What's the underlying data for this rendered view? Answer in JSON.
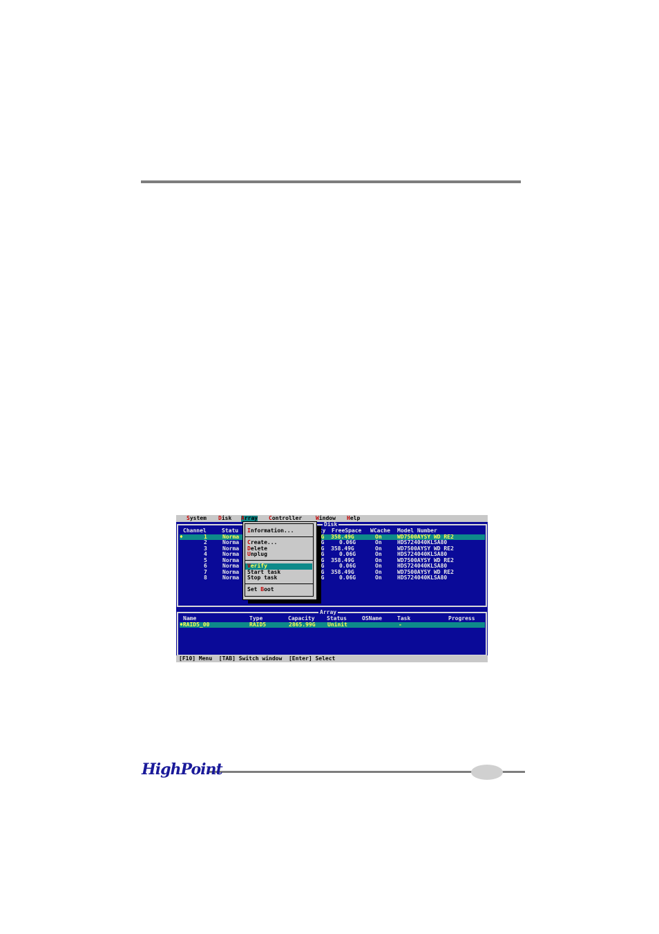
{
  "menubar": {
    "items": [
      {
        "hotkey": "S",
        "rest": "ystem"
      },
      {
        "hotkey": "D",
        "rest": "isk"
      },
      {
        "hotkey": "A",
        "rest": "rray"
      },
      {
        "hotkey": "C",
        "rest": "ontroller"
      },
      {
        "hotkey": "W",
        "rest": "indow"
      },
      {
        "hotkey": "H",
        "rest": "elp"
      }
    ]
  },
  "disk_panel": {
    "title": "Disk",
    "headers": {
      "channel": "Channel",
      "status": "Statu",
      "capacity": "ity",
      "freespace": "FreeSpace",
      "wcache": "WCache",
      "model": "Model Number"
    },
    "rows": [
      {
        "marker": "♦",
        "channel": "1",
        "status": "Norma",
        "cap": "92G",
        "free": "358.49G",
        "wcache": "On",
        "model": "WD7500AYSY WD RE2"
      },
      {
        "marker": "",
        "channel": "2",
        "status": "Norma",
        "cap": "49G",
        "free": "0.06G",
        "wcache": "On",
        "model": "HDS724040KLSA80"
      },
      {
        "marker": "",
        "channel": "3",
        "status": "Norma",
        "cap": "92G",
        "free": "358.49G",
        "wcache": "On",
        "model": "WD7500AYSY WD RE2"
      },
      {
        "marker": "",
        "channel": "4",
        "status": "Norma",
        "cap": "49G",
        "free": "0.06G",
        "wcache": "On",
        "model": "HDS724040KLSA80"
      },
      {
        "marker": "",
        "channel": "5",
        "status": "Norma",
        "cap": "72G",
        "free": "358.49G",
        "wcache": "On",
        "model": "WD7500AYSY WD RE2"
      },
      {
        "marker": "",
        "channel": "6",
        "status": "Norma",
        "cap": "49G",
        "free": "0.06G",
        "wcache": "On",
        "model": "HDS724040KLSA80"
      },
      {
        "marker": "",
        "channel": "7",
        "status": "Norma",
        "cap": "92G",
        "free": "358.49G",
        "wcache": "On",
        "model": "WD7500AYSY WD RE2"
      },
      {
        "marker": "",
        "channel": "8",
        "status": "Norma",
        "cap": "49G",
        "free": "0.06G",
        "wcache": "On",
        "model": "HDS724040KLSA80"
      }
    ]
  },
  "array_menu": {
    "items": [
      {
        "pre": "",
        "hotkey": "I",
        "rest": "nformation..."
      },
      {
        "pre": "",
        "hotkey": "C",
        "rest": "reate..."
      },
      {
        "pre": "",
        "hotkey": "D",
        "rest": "elete"
      },
      {
        "pre": "",
        "hotkey": "U",
        "rest": "nplug"
      },
      {
        "pre": "",
        "hotkey": "V",
        "rest": "erify"
      },
      {
        "pre": "Start task",
        "hotkey": "",
        "rest": ""
      },
      {
        "pre": "Stop task",
        "hotkey": "",
        "rest": ""
      },
      {
        "pre": "Set ",
        "hotkey": "B",
        "rest": "oot"
      }
    ]
  },
  "array_panel": {
    "title": "Array",
    "headers": {
      "name": "Name",
      "type": "Type",
      "capacity": "Capacity",
      "status": "Status",
      "osname": "OSName",
      "task": "Task",
      "progress": "Progress"
    },
    "rows": [
      {
        "name": "♦RAID5_00",
        "type": "RAID5",
        "capacity": "2865.99G",
        "status": "Uninit",
        "osname": "",
        "task": "-",
        "progress": ""
      }
    ]
  },
  "statusbar": {
    "text": "[F10] Menu  [TAB] Switch window  [Enter] Select"
  },
  "footer": {
    "logo": "HighPoint"
  }
}
